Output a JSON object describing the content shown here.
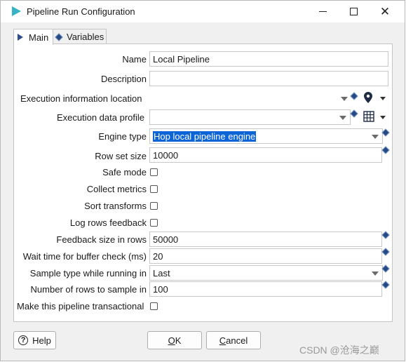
{
  "window": {
    "title": "Pipeline Run Configuration"
  },
  "tabs": [
    {
      "label": "Main",
      "active": true
    },
    {
      "label": "Variables",
      "active": false
    }
  ],
  "form": {
    "name": {
      "label": "Name",
      "value": "Local Pipeline"
    },
    "description": {
      "label": "Description",
      "value": ""
    },
    "execution_info_location": {
      "label": "Execution information location",
      "value": ""
    },
    "execution_data_profile": {
      "label": "Execution data profile",
      "value": ""
    },
    "engine_type": {
      "label": "Engine type",
      "value": "Hop local pipeline engine"
    },
    "row_set_size": {
      "label": "Row set size",
      "value": "10000"
    },
    "safe_mode": {
      "label": "Safe mode",
      "checked": false
    },
    "collect_metrics": {
      "label": "Collect metrics",
      "checked": false
    },
    "sort_transforms": {
      "label": "Sort transforms",
      "checked": false
    },
    "log_rows_feedback": {
      "label": "Log rows feedback",
      "checked": false
    },
    "feedback_size": {
      "label": "Feedback size in rows",
      "value": "50000"
    },
    "wait_time": {
      "label": "Wait time for buffer check (ms)",
      "value": "20"
    },
    "sample_type": {
      "label": "Sample type while running in",
      "value": "Last"
    },
    "rows_to_sample": {
      "label": "Number of rows to sample in",
      "value": "100"
    },
    "transactional": {
      "label": "Make this pipeline transactional",
      "checked": false
    }
  },
  "buttons": {
    "help": "Help",
    "ok_mnemonic": "O",
    "ok_rest": "K",
    "cancel_mnemonic": "C",
    "cancel_rest": "ancel"
  },
  "watermark": "CSDN @沧海之巅",
  "colors": {
    "accent": "#0c64d6",
    "icon": "#36b4c6",
    "variable_icon": "#254a83"
  }
}
